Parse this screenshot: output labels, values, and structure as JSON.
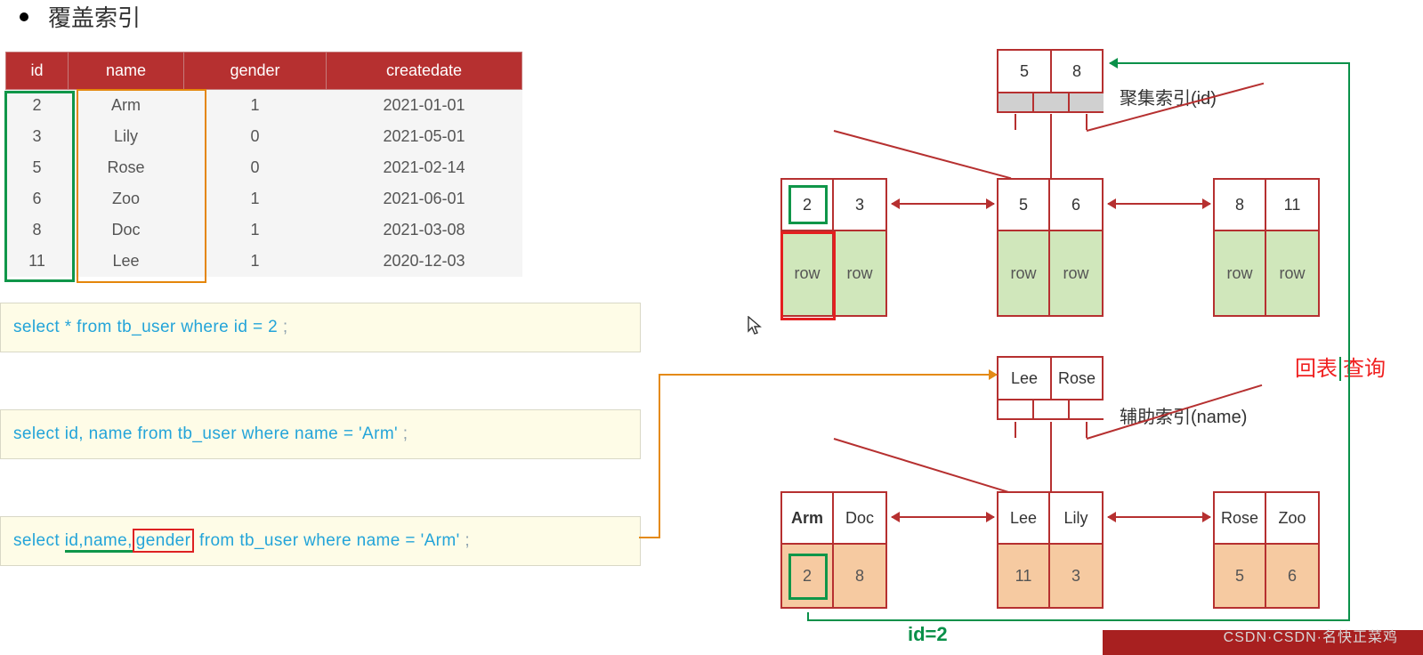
{
  "heading": "覆盖索引",
  "table": {
    "headers": {
      "id": "id",
      "name": "name",
      "gender": "gender",
      "date": "createdate"
    },
    "rows": [
      {
        "id": "2",
        "name": "Arm",
        "gender": "1",
        "date": "2021-01-01"
      },
      {
        "id": "3",
        "name": "Lily",
        "gender": "0",
        "date": "2021-05-01"
      },
      {
        "id": "5",
        "name": "Rose",
        "gender": "0",
        "date": "2021-02-14"
      },
      {
        "id": "6",
        "name": "Zoo",
        "gender": "1",
        "date": "2021-06-01"
      },
      {
        "id": "8",
        "name": "Doc",
        "gender": "1",
        "date": "2021-03-08"
      },
      {
        "id": "11",
        "name": "Lee",
        "gender": "1",
        "date": "2020-12-03"
      }
    ]
  },
  "sql": {
    "q1a": "select * from tb_user where id = 2 ",
    "q2a": "select id, name from tb_user where name = 'Arm' ",
    "q3_select": "select ",
    "q3_idname": "id,name,",
    "q3_gender": "gender",
    "q3_rest": " from tb_user where name = 'Arm' ",
    "semi": ";"
  },
  "labels": {
    "cluster": "聚集索引(id)",
    "secondary": "辅助索引(name)",
    "back_a": "回表",
    "back_b": "查询",
    "id2": "id=2",
    "row": "row"
  },
  "btree": {
    "cluster_root": [
      "5",
      "8"
    ],
    "cluster_leaves": [
      [
        "2",
        "3"
      ],
      [
        "5",
        "6"
      ],
      [
        "8",
        "11"
      ]
    ],
    "second_root": [
      "Lee",
      "Rose"
    ],
    "second_leaves": [
      {
        "k": [
          "Arm",
          "Doc"
        ],
        "v": [
          "2",
          "8"
        ]
      },
      {
        "k": [
          "Lee",
          "Lily"
        ],
        "v": [
          "11",
          "3"
        ]
      },
      {
        "k": [
          "Rose",
          "Zoo"
        ],
        "v": [
          "5",
          "6"
        ]
      }
    ]
  },
  "watermark": "CSDN·CSDN·名快正菜鸡"
}
